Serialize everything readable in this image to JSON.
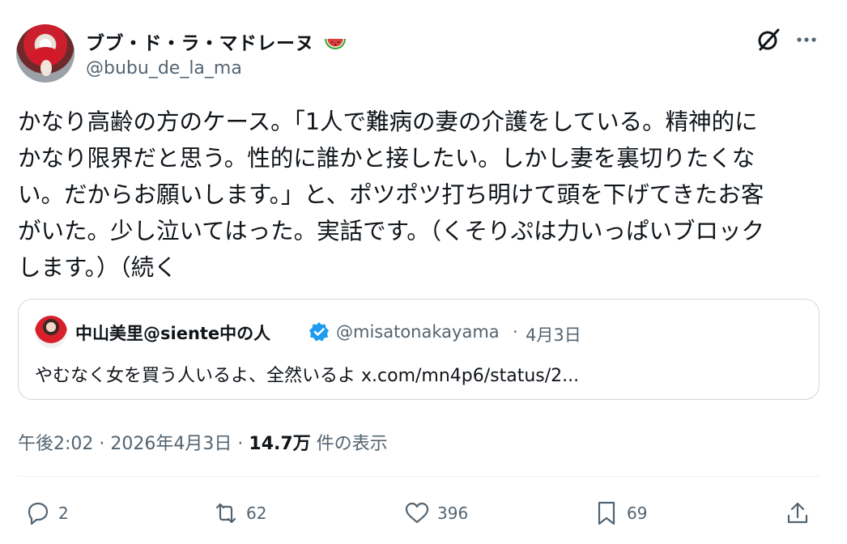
{
  "author": {
    "display_name": "ブブ・ド・ラ・マドレーヌ",
    "emoji": "watermelon-icon",
    "handle": "@bubu_de_la_ma"
  },
  "tweet": {
    "text": "かなり高齢の方のケース。「1人で難病の妻の介護をしている。精神的に\nかなり限界だと思う。性的に誰かと接したい。しかし妻を裏切りたくな\nい。だからお願いします。」と、ポツポツ打ち明けて頭を下げてきたお客\nがいた。少し泣いてはった。実話です。（くそりぷは力いっぱいブロック\nします。）（続く"
  },
  "quote": {
    "display_name": "中山美里@siente中の人",
    "handle": "@misatonakayama",
    "separator": "·",
    "date": "4月3日",
    "text": "やむなく女を買う人いるよ、全然いるよ x.com/mn4p6/status/2..."
  },
  "meta": {
    "time": "午後2:02",
    "sep1": "·",
    "date": "2026年4月3日",
    "sep2": "·",
    "views": "14.7万",
    "views_label": "件の表示"
  },
  "actions": {
    "replies": "2",
    "reposts": "62",
    "likes": "396",
    "bookmarks": "69"
  },
  "colors": {
    "text": "#0f1419",
    "secondary": "#536471",
    "border": "#cfd9de",
    "verified": "#1d9bf0"
  }
}
